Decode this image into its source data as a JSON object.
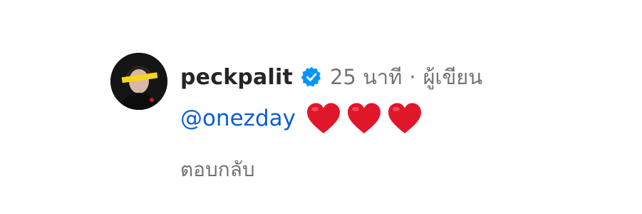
{
  "comment": {
    "username": "peckpalit",
    "timestamp": "25 นาที",
    "separator": "·",
    "author_label": "ผู้เขียน",
    "mention": "@onezday",
    "hearts": [
      "red-heart",
      "red-heart",
      "red-heart"
    ],
    "reply_label": "ตอบกลับ"
  },
  "colors": {
    "username": "#262626",
    "meta": "#737373",
    "mention": "#0b5fd1",
    "verified": "#0095f6",
    "heart": "#e0162b"
  },
  "icons": {
    "verified": "verified-badge-icon",
    "heart": "red-heart-icon"
  }
}
